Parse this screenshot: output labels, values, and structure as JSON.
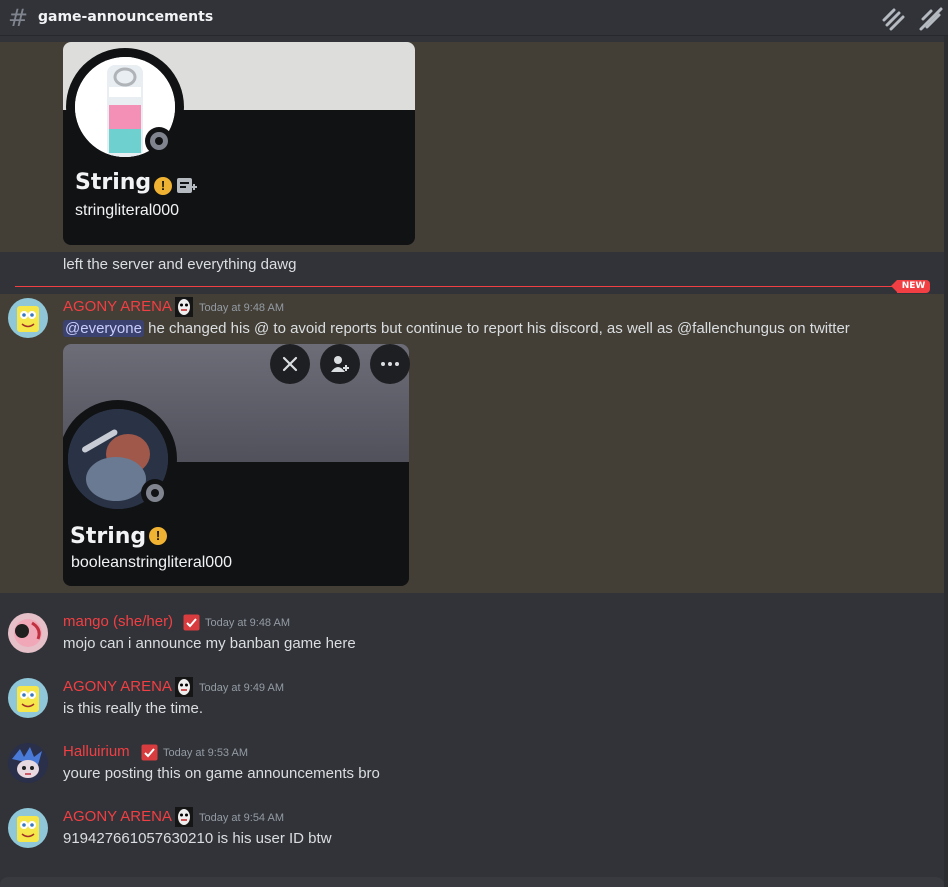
{
  "channel": {
    "name": "game-announcements"
  },
  "embed1": {
    "display_name": "String",
    "username": "stringliteral000"
  },
  "message0": {
    "text": "left the server and everything dawg"
  },
  "divider": {
    "label": "NEW"
  },
  "messages": [
    {
      "author": "AGONY ARENA",
      "time": "Today at 9:48 AM",
      "mention": "@everyone",
      "text": " he changed his @ to avoid reports but continue to report his discord, as well as @fallenchungus on twitter",
      "embed": {
        "display_name": "String",
        "username": "booleanstringliteral000"
      }
    },
    {
      "author": "mango (she/her)",
      "time": "Today at 9:48 AM",
      "text": "mojo can i announce my banban game here"
    },
    {
      "author": "AGONY ARENA",
      "time": "Today at 9:49 AM",
      "text": "is this really the time."
    },
    {
      "author": "Halluirium",
      "time": "Today at 9:53 AM",
      "text": "youre posting this on game announcements bro"
    },
    {
      "author": "AGONY ARENA",
      "time": "Today at 9:54 AM",
      "text": "919427661057630210 is his user ID btw"
    }
  ],
  "colors": {
    "background": "#313338",
    "highlight": "#433f36",
    "author_red": "#f23f43",
    "mention_bg": "#3c4270",
    "warning": "#f0b232"
  },
  "icons": [
    "hash-icon",
    "threads-icon",
    "mute-icon",
    "warning-icon",
    "add-note-icon",
    "close-sword-icon",
    "add-friend-icon",
    "more-icon",
    "checkbox-badge-icon",
    "face-role-icon"
  ]
}
